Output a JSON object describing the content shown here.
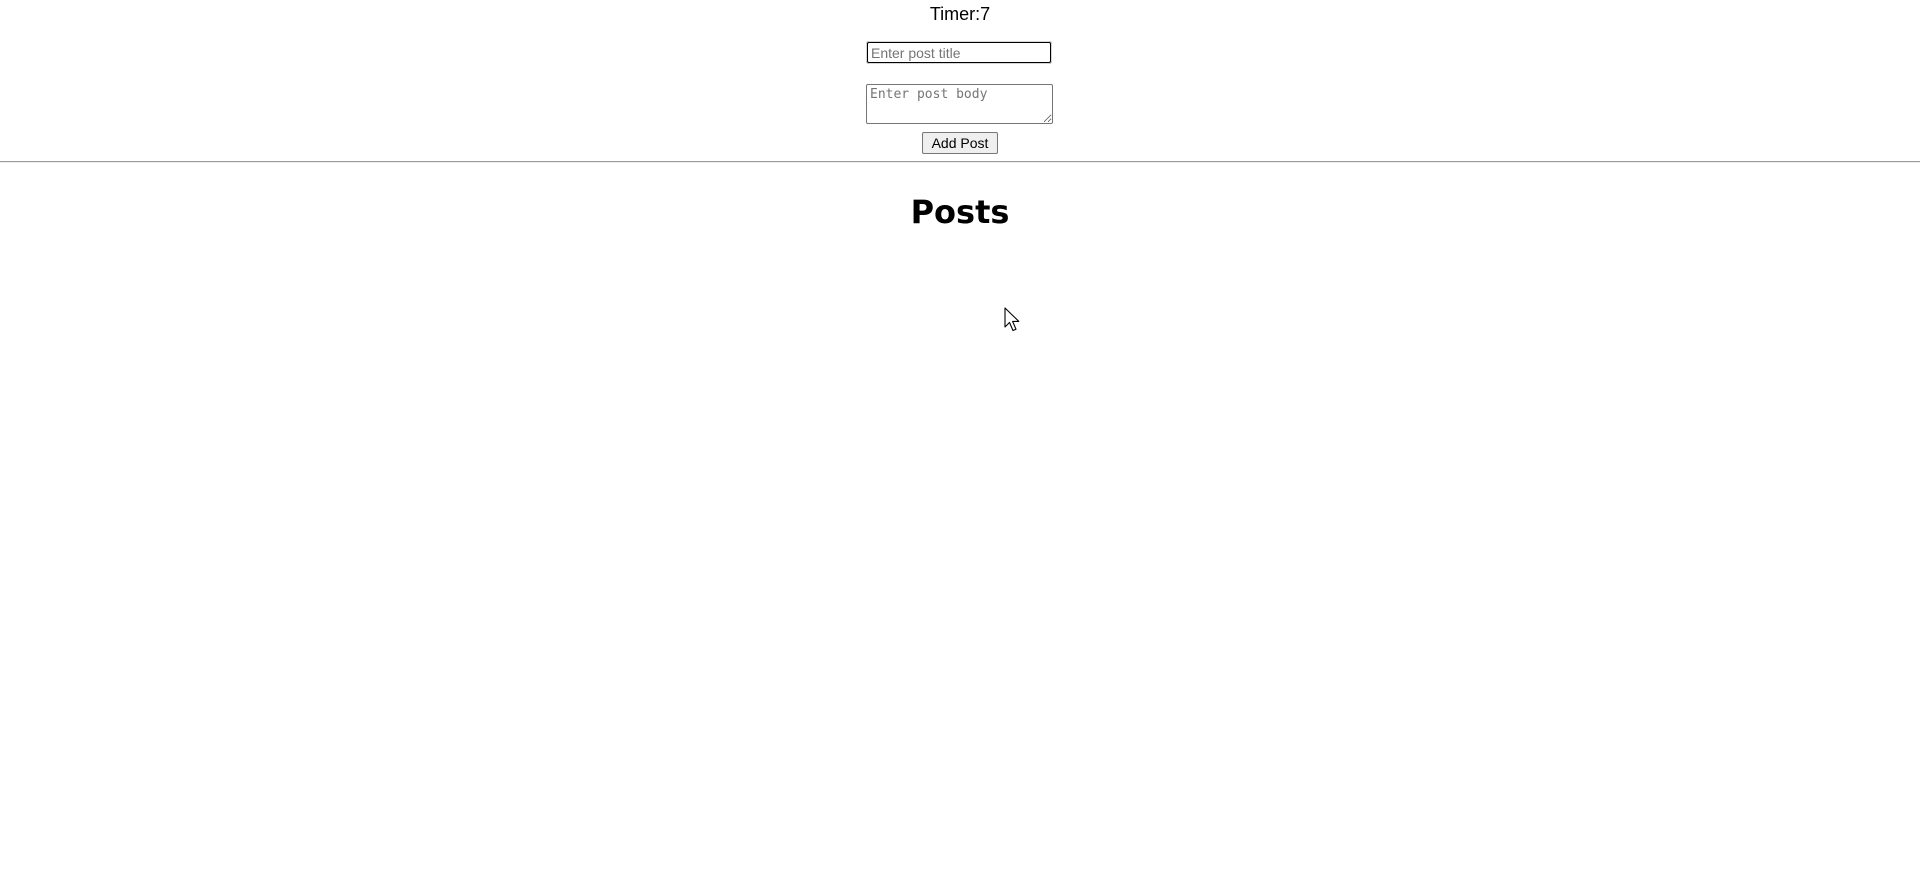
{
  "timer": {
    "label": "Timer:",
    "value": "7"
  },
  "form": {
    "title_placeholder": "Enter post title",
    "title_value": "",
    "body_placeholder": "Enter post body",
    "body_value": "",
    "add_button_label": "Add Post"
  },
  "posts": {
    "heading": "Posts",
    "items": []
  },
  "cursor": {
    "icon": "mouse-pointer-icon"
  }
}
